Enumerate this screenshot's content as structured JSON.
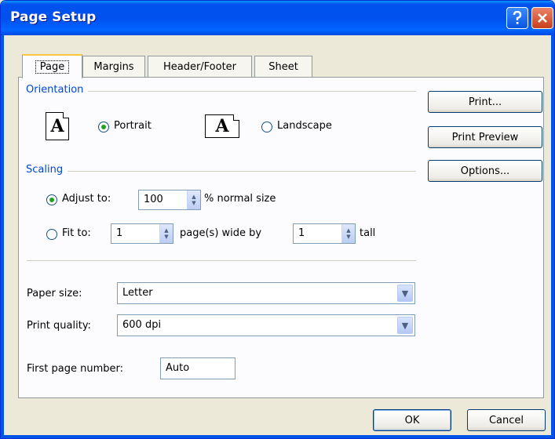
{
  "window": {
    "title": "Page Setup"
  },
  "tabs": [
    "Page",
    "Margins",
    "Header/Footer",
    "Sheet"
  ],
  "orientation": {
    "heading": "Orientation",
    "portrait_icon_glyph": "A",
    "landscape_icon_glyph": "A",
    "portrait_label": "Portrait",
    "landscape_label": "Landscape",
    "selected": "Portrait"
  },
  "scaling": {
    "heading": "Scaling",
    "adjust_label": "Adjust to:",
    "adjust_value": "100",
    "adjust_suffix": "% normal size",
    "fit_label": "Fit to:",
    "fit_wide_value": "1",
    "fit_wide_suffix": "page(s) wide by",
    "fit_tall_value": "1",
    "fit_tall_suffix": "tall",
    "selected": "Adjust to"
  },
  "paper": {
    "size_label": "Paper size:",
    "size_value": "Letter",
    "quality_label": "Print quality:",
    "quality_value": "600 dpi"
  },
  "first_page": {
    "label": "First page number:",
    "value": "Auto"
  },
  "side_buttons": {
    "print": "Print...",
    "print_preview": "Print Preview",
    "options": "Options..."
  },
  "footer_buttons": {
    "ok": "OK",
    "cancel": "Cancel"
  }
}
